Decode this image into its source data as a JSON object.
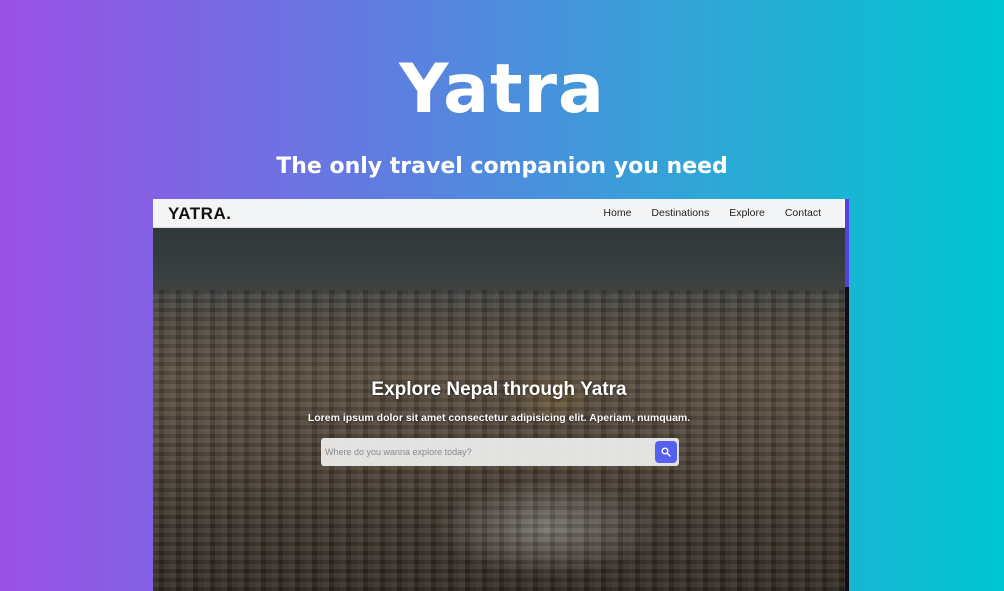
{
  "hero": {
    "title": "Yatra",
    "tagline": "The only travel companion you need"
  },
  "site": {
    "brand": "YATRA.",
    "nav": [
      {
        "label": "Home"
      },
      {
        "label": "Destinations"
      },
      {
        "label": "Explore"
      },
      {
        "label": "Contact"
      }
    ],
    "heading": "Explore Nepal through Yatra",
    "subheading": "Lorem ipsum dolor sit amet consectetur adipisicing elit. Aperiam, numquam.",
    "search": {
      "placeholder": "Where do you wanna explore today?",
      "value": "",
      "button_icon": "search-icon"
    }
  },
  "colors": {
    "gradient_start": "#9a50e6",
    "gradient_end": "#00c6d1",
    "accent": "#5660f0",
    "scroll_thumb": "#5a3fe0"
  }
}
